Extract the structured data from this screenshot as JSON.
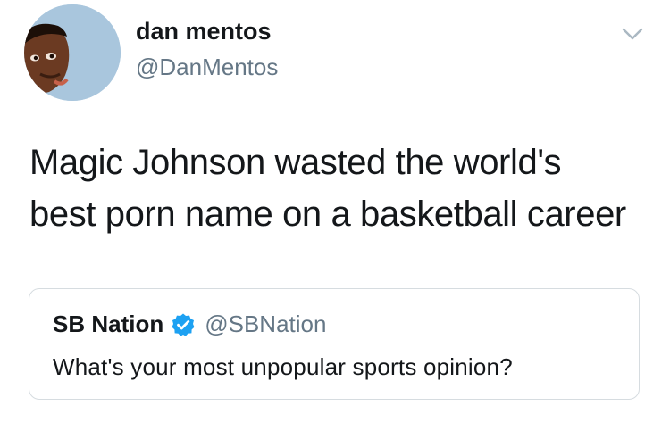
{
  "tweet": {
    "author": {
      "display_name": "dan mentos",
      "handle": "@DanMentos",
      "avatar_icon": "profile-photo"
    },
    "menu_icon": "chevron-down-icon",
    "text_lines": [
      "Magic Johnson wasted the world's",
      "best porn name on a basketball career"
    ],
    "quoted_tweet": {
      "display_name": "SB Nation",
      "verified_icon": "verified-badge-icon",
      "handle": "@SBNation",
      "text": "What's your most unpopular sports opinion?"
    }
  },
  "colors": {
    "text_primary": "#14171a",
    "text_secondary": "#657786",
    "verified_blue": "#1da1f2",
    "card_border": "#d6dce0",
    "avatar_background": "#a9c6dd"
  }
}
